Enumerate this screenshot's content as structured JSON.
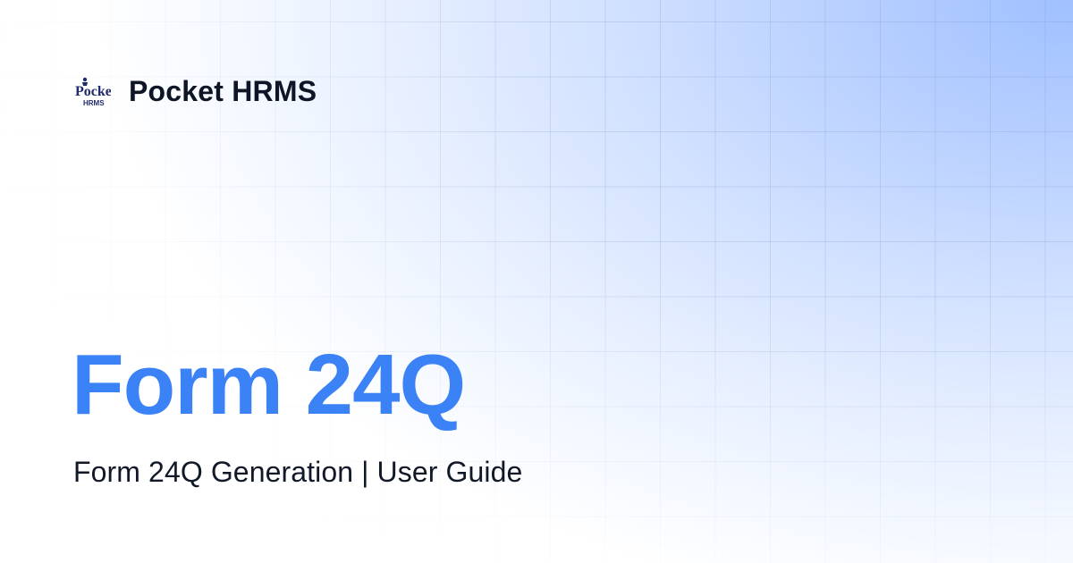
{
  "brand": {
    "logo_text_top": "Pocket",
    "logo_text_bottom": "HRMS",
    "name": "Pocket HRMS"
  },
  "hero": {
    "title": "Form 24Q",
    "subtitle": "Form 24Q Generation | User Guide"
  },
  "colors": {
    "accent": "#3b82f6",
    "logo_navy": "#1e2a6b",
    "text_dark": "#0d1526",
    "gradient_light_blue": "#9fc0ff"
  }
}
